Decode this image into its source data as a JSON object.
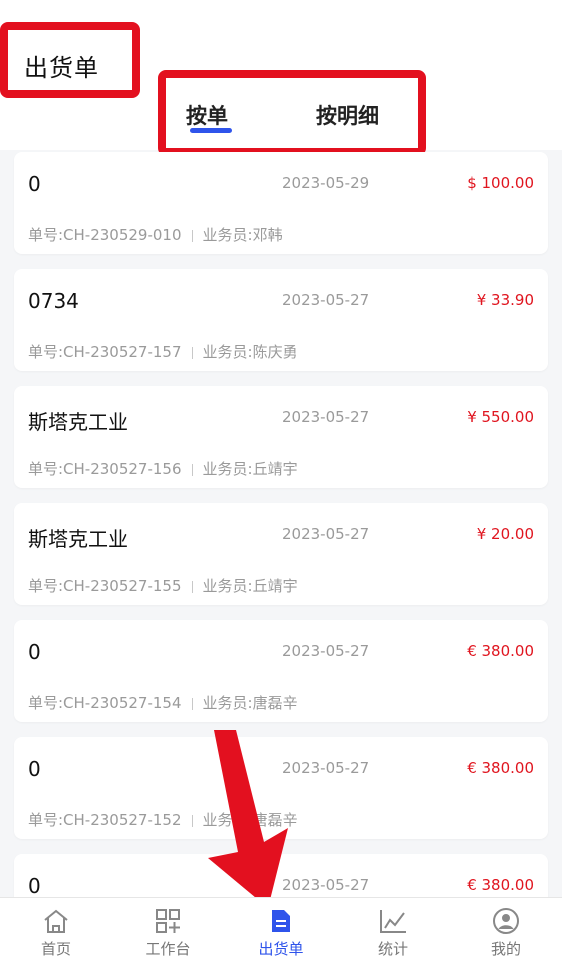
{
  "header": {
    "title": "出货单"
  },
  "tabs": [
    {
      "label": "按单"
    },
    {
      "label": "按明细"
    }
  ],
  "orders": [
    {
      "name": "0",
      "date": "2023-05-29",
      "amount": "$ 100.00",
      "order_no": "单号:CH-230529-010",
      "salesperson": "业务员:邓韩"
    },
    {
      "name": "0734",
      "date": "2023-05-27",
      "amount": "¥ 33.90",
      "order_no": "单号:CH-230527-157",
      "salesperson": "业务员:陈庆勇"
    },
    {
      "name": "斯塔克工业",
      "date": "2023-05-27",
      "amount": "¥ 550.00",
      "order_no": "单号:CH-230527-156",
      "salesperson": "业务员:丘靖宇"
    },
    {
      "name": "斯塔克工业",
      "date": "2023-05-27",
      "amount": "¥ 20.00",
      "order_no": "单号:CH-230527-155",
      "salesperson": "业务员:丘靖宇"
    },
    {
      "name": "0",
      "date": "2023-05-27",
      "amount": "€ 380.00",
      "order_no": "单号:CH-230527-154",
      "salesperson": "业务员:唐磊辛"
    },
    {
      "name": "0",
      "date": "2023-05-27",
      "amount": "€ 380.00",
      "order_no": "单号:CH-230527-152",
      "salesperson": "业务员:唐磊辛"
    },
    {
      "name": "0",
      "date": "2023-05-27",
      "amount": "€ 380.00",
      "order_no": "",
      "salesperson": ""
    }
  ],
  "bottom_nav": [
    {
      "label": "首页",
      "icon": "home-icon"
    },
    {
      "label": "工作台",
      "icon": "grid-plus-icon"
    },
    {
      "label": "出货单",
      "icon": "document-icon",
      "active": true
    },
    {
      "label": "统计",
      "icon": "line-chart-icon"
    },
    {
      "label": "我的",
      "icon": "user-icon"
    }
  ],
  "colors": {
    "accent": "#2f54eb",
    "amount": "#e0151f",
    "highlight": "#e3101f"
  }
}
